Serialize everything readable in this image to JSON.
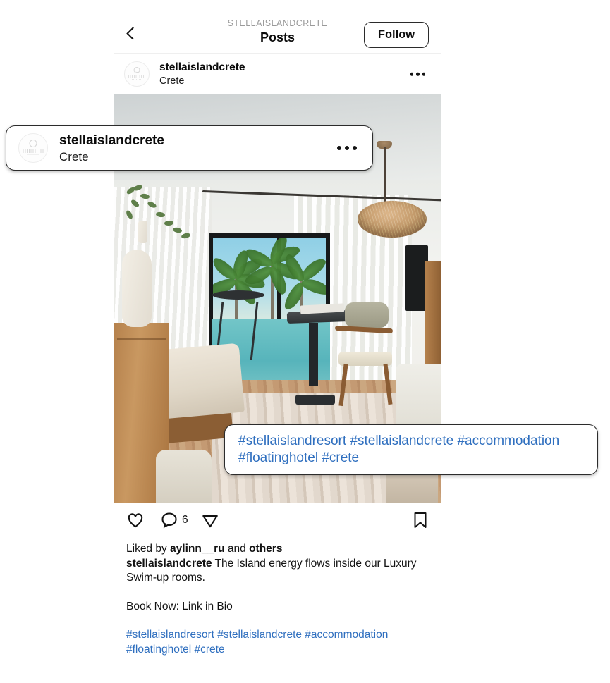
{
  "header": {
    "back_icon": "chevron-left-icon",
    "eyebrow": "STELLAISLANDCRETE",
    "title": "Posts",
    "follow_label": "Follow"
  },
  "account": {
    "avatar_icon": "profile-avatar-logo",
    "username": "stellaislandcrete",
    "location": "Crete",
    "more_icon": "more-options-icon"
  },
  "callout_account": {
    "avatar_icon": "profile-avatar-logo",
    "username": "stellaislandcrete",
    "location": "Crete",
    "more_icon": "more-options-icon"
  },
  "callout_tags": {
    "line1": "#stellaislandresort #stellaislandcrete #accommodation",
    "line2": "#floatinghotel #crete"
  },
  "photo": {
    "alt_description": "Luxury swim-up hotel room interior with sheer curtains, rattan pendant lamp, wooden floor, dining table, armchair and pool view with palm trees"
  },
  "actions": {
    "like_icon": "heart-icon",
    "comment_icon": "comment-icon",
    "comment_count": "6",
    "share_icon": "share-paper-plane-icon",
    "save_icon": "bookmark-icon"
  },
  "caption": {
    "liked_prefix": "Liked by ",
    "liked_user": "aylinn__ru",
    "liked_mid": " and ",
    "liked_suffix": "others",
    "author": "stellaislandcrete",
    "text": " The Island energy flows inside our Luxury Swim-up rooms.",
    "book_now": "Book Now: Link in Bio",
    "hashtags_line1": "#stellaislandresort #stellaislandcrete #accommodation",
    "hashtags_line2": "#floatinghotel #crete"
  },
  "colors": {
    "link_blue": "#2f6fbf",
    "text_dark": "#121212",
    "muted_gray": "#9a9a9a",
    "divider": "#efefef"
  }
}
